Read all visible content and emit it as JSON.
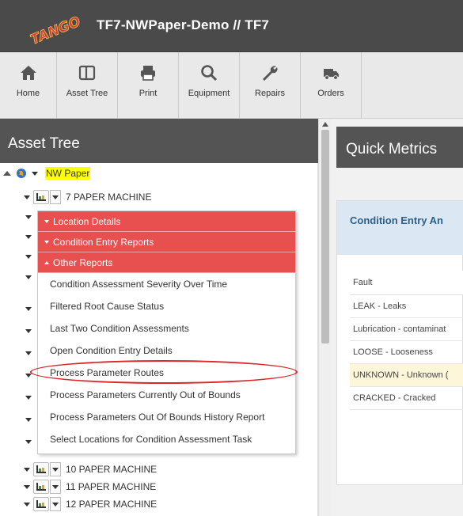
{
  "header": {
    "logo_text": "TANGO",
    "title": "TF7-NWPaper-Demo  // TF7"
  },
  "toolbar": {
    "items": [
      {
        "label": "Home",
        "icon": "home-icon"
      },
      {
        "label": "Asset Tree",
        "icon": "asset-tree-icon"
      },
      {
        "label": "Print",
        "icon": "print-icon"
      },
      {
        "label": "Equipment",
        "icon": "search-icon"
      },
      {
        "label": "Repairs",
        "icon": "wrench-icon"
      },
      {
        "label": "Orders",
        "icon": "truck-icon"
      }
    ]
  },
  "asset_tree": {
    "title": "Asset Tree",
    "root": {
      "label": "NW Paper",
      "icon": "globe-icon"
    },
    "expanded_node": {
      "label": "7 PAPER MACHINE",
      "icon": "machine-icon"
    },
    "collapsed_nodes": [
      {
        "label": "10 PAPER MACHINE"
      },
      {
        "label": "11 PAPER MACHINE"
      },
      {
        "label": "12 PAPER MACHINE"
      }
    ]
  },
  "context_menu": {
    "sections": [
      {
        "label": "Location Details",
        "state": "collapsed"
      },
      {
        "label": "Condition Entry Reports",
        "state": "collapsed"
      },
      {
        "label": "Other Reports",
        "state": "expanded"
      }
    ],
    "items": [
      "Condition Assessment Severity Over Time",
      "Filtered Root Cause Status",
      "Last Two Condition Assessments",
      "Open Condition Entry Details",
      "Process Parameter Routes",
      "Process Parameters Currently Out of Bounds",
      "Process Parameters Out Of Bounds History Report",
      "Select Locations for Condition Assessment Task"
    ],
    "highlighted_item": "Process Parameters Currently Out of Bounds"
  },
  "quick_metrics": {
    "title": "Quick Metrics",
    "card_title": "Condition Entry An",
    "table": {
      "header": "Fault",
      "rows": [
        "LEAK - Leaks",
        "Lubrication - contaminat",
        "LOOSE - Looseness",
        "UNKNOWN - Unknown (",
        "CRACKED - Cracked"
      ]
    }
  },
  "colors": {
    "header_bg": "#4a4a4a",
    "menu_red": "#e84f4f",
    "highlight_yellow": "#ffff00",
    "circle_red": "#d9262b",
    "card_title_bg": "#dbe8f3"
  }
}
